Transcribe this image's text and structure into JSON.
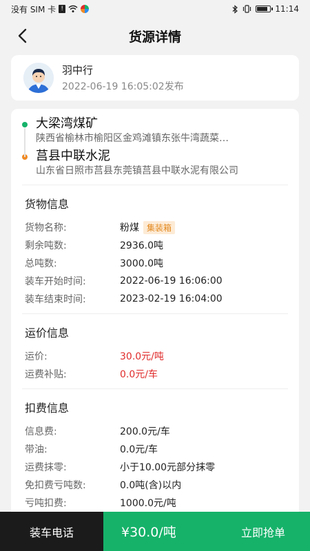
{
  "status_bar": {
    "carrier": "没有 SIM 卡",
    "time": "11:14",
    "battery_level": 0.85
  },
  "header": {
    "title": "货源详情"
  },
  "publisher": {
    "name": "羽中行",
    "published": "2022-06-19 16:05:02发布"
  },
  "route": {
    "origin": {
      "name": "大梁湾煤矿",
      "address": "陕西省榆林市榆阳区金鸡滩镇东张牛湾蔬菜…",
      "dot_color": "#16b26a"
    },
    "destination": {
      "name": "莒县中联水泥",
      "address": "山东省日照市莒县东莞镇莒县中联水泥有限公司",
      "dot_color": "#f08a24"
    }
  },
  "cargo": {
    "title": "货物信息",
    "rows": [
      {
        "label": "货物名称:",
        "value": "粉煤",
        "tag": "集装箱"
      },
      {
        "label": "剩余吨数:",
        "value": "2936.0吨"
      },
      {
        "label": "总吨数:",
        "value": "3000.0吨"
      },
      {
        "label": "装车开始时间:",
        "value": "2022-06-19 16:06:00"
      },
      {
        "label": "装车结束时间:",
        "value": "2023-02-19 16:04:00"
      }
    ]
  },
  "freight": {
    "title": "运价信息",
    "rows": [
      {
        "label": "运价:",
        "value": "30.0元/吨"
      },
      {
        "label": "运费补贴:",
        "value": "0.0元/车"
      }
    ],
    "accent": "#e02b2b"
  },
  "deductions": {
    "title": "扣费信息",
    "rows": [
      {
        "label": "信息费:",
        "value": "200.0元/车"
      },
      {
        "label": "带油:",
        "value": "0.0元/车"
      },
      {
        "label": "运费抹零:",
        "value": "小于10.00元部分抹零"
      },
      {
        "label": "免扣费亏吨数:",
        "value": "0.0吨(含)以内"
      },
      {
        "label": "亏吨扣费:",
        "value": "1000.0元/吨"
      }
    ]
  },
  "bottom_bar": {
    "phone_label": "装车电话",
    "price": "¥30.0/吨",
    "grab_label": "立即抢单",
    "green": "#16b26a"
  }
}
